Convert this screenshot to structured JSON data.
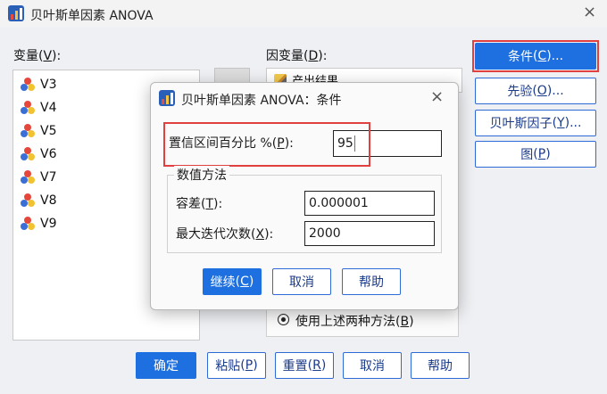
{
  "window": {
    "title": "贝叶斯单因素 ANOVA",
    "close_glyph": "×"
  },
  "variables_panel": {
    "label": "变量",
    "mnemonic": "V",
    "label_suffix": ":",
    "items": [
      "V3",
      "V4",
      "V5",
      "V6",
      "V7",
      "V8",
      "V9"
    ]
  },
  "dependent_panel": {
    "label": "因变量",
    "mnemonic": "D",
    "label_suffix": ":",
    "item": "产出结果"
  },
  "side_buttons": [
    {
      "label": "条件",
      "mnemonic": "C",
      "suffix": "..."
    },
    {
      "label": "先验",
      "mnemonic": "O",
      "suffix": "..."
    },
    {
      "label": "贝叶斯因子",
      "mnemonic": "Y",
      "suffix": "..."
    },
    {
      "label": "图",
      "mnemonic": "P",
      "suffix": ""
    }
  ],
  "radio_option": {
    "label": "使用上述两种方法",
    "mnemonic": "B"
  },
  "bottom_buttons": [
    {
      "label": "确定",
      "mnemonic": ""
    },
    {
      "label": "粘贴",
      "mnemonic": "P"
    },
    {
      "label": "重置",
      "mnemonic": "R"
    },
    {
      "label": "取消",
      "mnemonic": ""
    },
    {
      "label": "帮助",
      "mnemonic": ""
    }
  ],
  "modal": {
    "title": "贝叶斯单因素 ANOVA：条件",
    "close_glyph": "×",
    "confidence": {
      "label": "置信区间百分比 %",
      "mnemonic": "P",
      "suffix": ":",
      "value": "95"
    },
    "numeric_group": {
      "title": "数值方法",
      "tolerance_label": "容差",
      "tolerance_mnemonic": "T",
      "tolerance_suffix": ":",
      "tolerance_value": "0.000001",
      "iterations_label": "最大迭代次数",
      "iterations_mnemonic": "X",
      "iterations_suffix": ":",
      "iterations_value": "2000"
    },
    "buttons": [
      {
        "label": "继续",
        "mnemonic": "C"
      },
      {
        "label": "取消",
        "mnemonic": ""
      },
      {
        "label": "帮助",
        "mnemonic": ""
      }
    ]
  },
  "colors": {
    "accent": "#1e6fe0",
    "highlight_frame": "#e0403f"
  },
  "icons": {
    "app": "spss-app-icon",
    "variable": "scale-variable-icon",
    "dependent": "pencil-icon"
  }
}
